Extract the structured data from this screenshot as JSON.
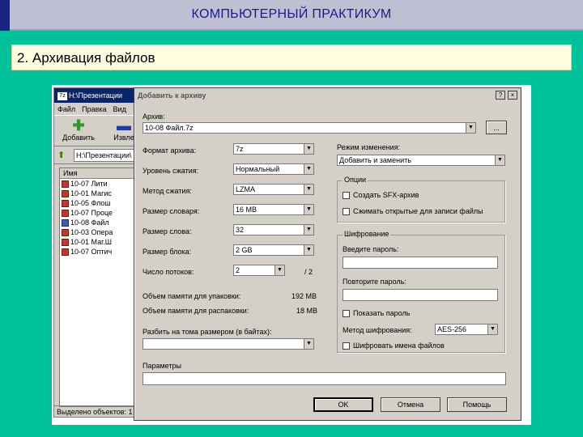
{
  "slide": {
    "title": "КОМПЬЮТЕРНЫЙ ПРАКТИКУМ",
    "subtitle": "2. Архивация файлов"
  },
  "background_window": {
    "title": "Н:\\Презентации",
    "app_icon_text": "7z",
    "menu": [
      "Файл",
      "Правка",
      "Вид"
    ],
    "toolbar": [
      {
        "label": "Добавить",
        "icon": "add-icon"
      },
      {
        "label": "Извле",
        "icon": "extract-icon"
      }
    ],
    "address": "Н:\\Презентации\\",
    "column_header": "Имя",
    "files": [
      {
        "name": "10-07 Лити",
        "icon": "file-icon"
      },
      {
        "name": "10-01 Магис",
        "icon": "file-icon"
      },
      {
        "name": "10-05 Флош",
        "icon": "file-icon"
      },
      {
        "name": "10-07 Проце",
        "icon": "file-icon"
      },
      {
        "name": "10-08 Файл",
        "icon": "blue-file-icon"
      },
      {
        "name": "10-03 Опера",
        "icon": "file-icon"
      },
      {
        "name": "10-01 Маг.Ш",
        "icon": "file-icon"
      },
      {
        "name": "10-07 Оптич",
        "icon": "file-icon"
      }
    ],
    "status": "Выделено объектов: 1"
  },
  "dialog": {
    "title": "Добавить к архиву",
    "archive_label": "Архив:",
    "archive_value": "10-08 Файл.7z",
    "browse_label": "...",
    "left_fields": [
      {
        "label": "Формат архива:",
        "value": "7z"
      },
      {
        "label": "Уровень сжатия:",
        "value": "Нормальный"
      },
      {
        "label": "Метод сжатия:",
        "value": "LZMA"
      },
      {
        "label": "Размер словаря:",
        "value": "16 MB"
      },
      {
        "label": "Размер слова:",
        "value": "32"
      },
      {
        "label": "Размер блока:",
        "value": "2 GB"
      }
    ],
    "threads_label": "Число потоков:",
    "threads_value": "2",
    "threads_max": "/ 2",
    "memory_compress_label": "Объем памяти для упаковки:",
    "memory_compress_value": "192 MB",
    "memory_decompress_label": "Объем памяти для распаковки:",
    "memory_decompress_value": "18 MB",
    "split_label": "Разбить на тома размером (в байтах):",
    "split_value": "",
    "params_label": "Параметры",
    "params_value": "",
    "update_mode_label": "Режим изменения:",
    "update_mode_value": "Добавить и заменить",
    "options_group": "Опции",
    "options": [
      "Создать SFX-архив",
      "Сжимать открытые для записи файлы"
    ],
    "encryption_group": "Шифрование",
    "password_label": "Введите пароль:",
    "password_repeat_label": "Повторите пароль:",
    "show_password_label": "Показать пароль",
    "encryption_method_label": "Метод шифрования:",
    "encryption_method_value": "AES-256",
    "encrypt_names_label": "Шифровать имена файлов",
    "buttons": {
      "ok": "OK",
      "cancel": "Отмена",
      "help": "Помощь"
    },
    "help_btn": "?",
    "close_btn": "×"
  }
}
